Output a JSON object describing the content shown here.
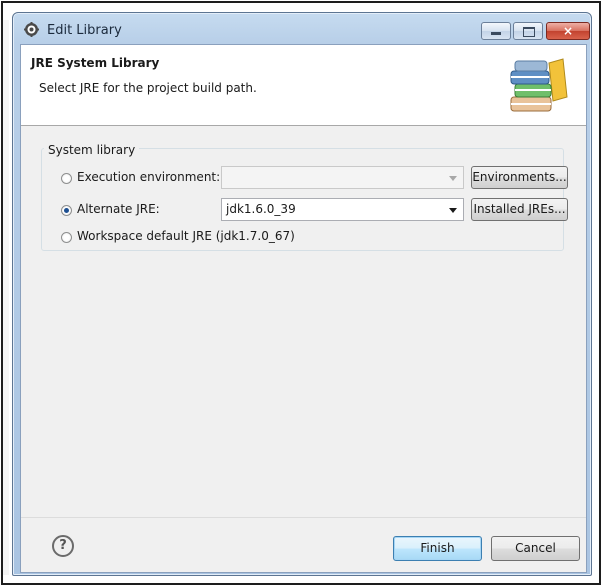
{
  "window": {
    "title": "Edit Library",
    "close_glyph": "×"
  },
  "header": {
    "title": "JRE System Library",
    "description": "Select JRE for the project build path."
  },
  "group": {
    "label": "System library",
    "options": [
      {
        "label": "Execution environment:",
        "selected": false,
        "combo_value": "",
        "combo_enabled": false,
        "button_label": "Environments..."
      },
      {
        "label": "Alternate JRE:",
        "selected": true,
        "combo_value": "jdk1.6.0_39",
        "combo_enabled": true,
        "button_label": "Installed JREs..."
      },
      {
        "label": "Workspace default JRE (jdk1.7.0_67)",
        "selected": false
      }
    ]
  },
  "footer": {
    "help_glyph": "?",
    "finish_label": "Finish",
    "cancel_label": "Cancel"
  },
  "icons": {
    "app": "eclipse-gear-icon",
    "banner": "books-icon",
    "help": "question-circle-icon"
  }
}
